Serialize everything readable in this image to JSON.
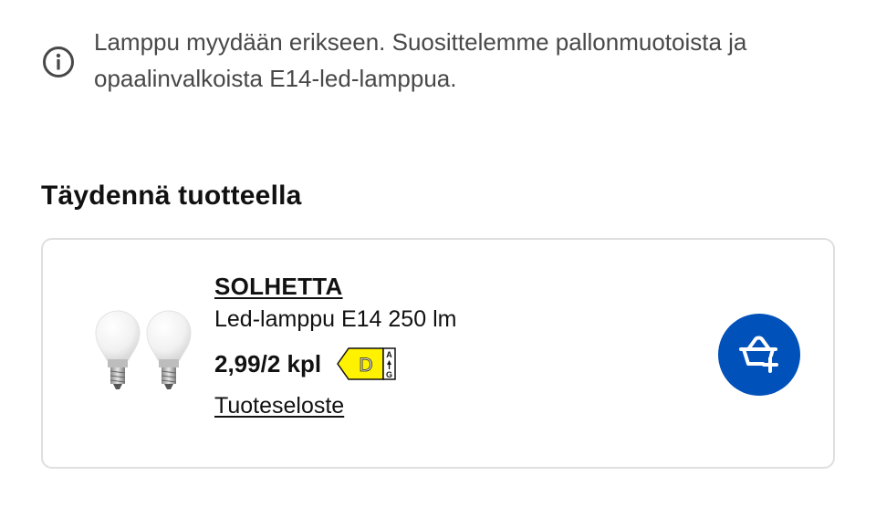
{
  "info": {
    "icon": "info-icon",
    "text": "Lamppu myydään erikseen. Suosittelemme pallonmuotoista ja opaalinvalkoista E14-led-lamppua."
  },
  "section": {
    "title": "Täydennä tuotteella"
  },
  "product": {
    "image_icon": "led-bulb-pair-image",
    "name": "SOLHETTA",
    "description": "Led-lamppu E14 250 lm",
    "price": "2,99/2 kpl",
    "energy_class": {
      "grade": "D",
      "scale_top": "A",
      "scale_bottom": "G",
      "color": "#fff200"
    },
    "link_label": "Tuoteseloste",
    "add_button_icon": "add-to-basket-icon",
    "accent_color": "#0051ba"
  }
}
